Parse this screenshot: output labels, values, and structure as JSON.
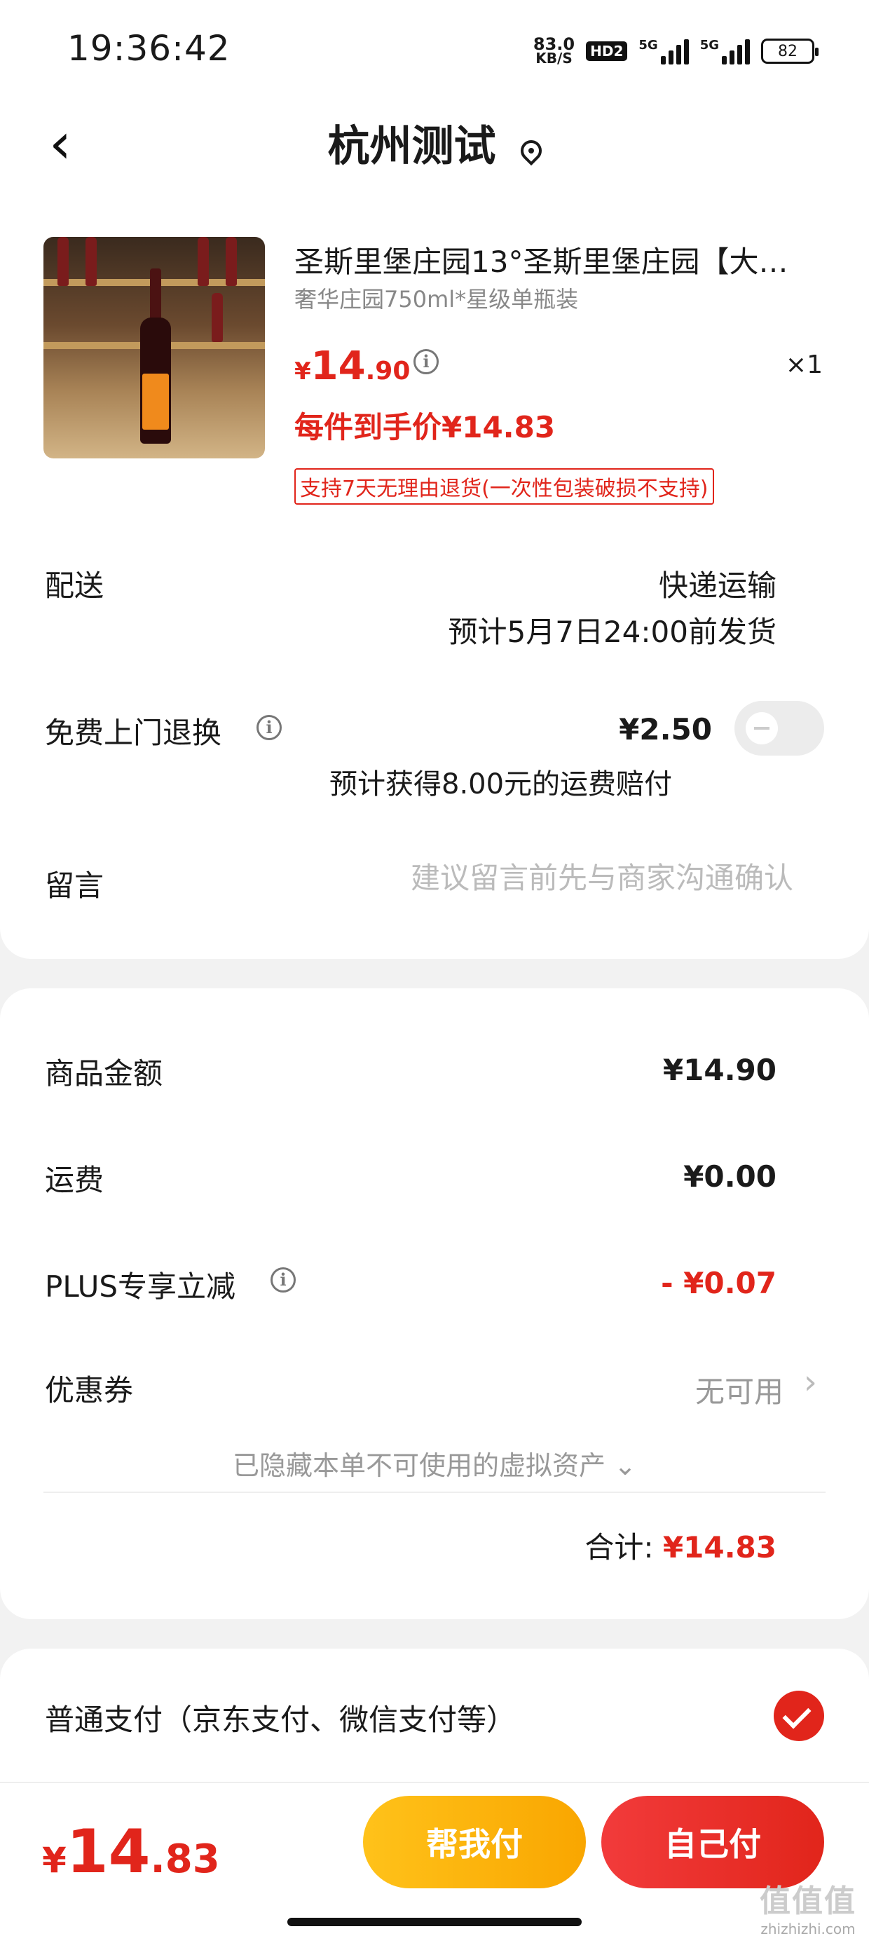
{
  "status_bar": {
    "time": "19:36:42",
    "net_speed_value": "83.0",
    "net_speed_unit": "KB/S",
    "hd_badge": "HD2",
    "signal1_tag": "5G",
    "signal2_tag": "5G",
    "battery": "82"
  },
  "header": {
    "back_icon": "chevron-left-icon",
    "title": "杭州测试",
    "location_icon": "location-pin-icon"
  },
  "product": {
    "image_icon": "wine-bottle-image",
    "name": "圣斯里堡庄园13°圣斯里堡庄园【大…",
    "spec": "奢华庄园750ml*星级单瓶装",
    "price_currency": "¥",
    "price_int": "14",
    "price_dec": ".90",
    "quantity": "×1",
    "per_item_price": "每件到手价¥14.83",
    "return_policy": "支持7天无理由退货(一次性包装破损不支持)"
  },
  "delivery": {
    "label": "配送",
    "method": "快递运输",
    "eta": "预计5月7日24:00前发货"
  },
  "free_return": {
    "label": "免费上门退换",
    "price": "¥2.50",
    "enabled": false,
    "compensation": "预计获得8.00元的运费赔付"
  },
  "message": {
    "label": "留言",
    "placeholder": "建议留言前先与商家沟通确认"
  },
  "summary": {
    "goods_label": "商品金额",
    "goods_value": "¥14.90",
    "shipping_label": "运费",
    "shipping_value": "¥0.00",
    "plus_label": "PLUS专享立减",
    "plus_value": "- ¥0.07",
    "coupon_label": "优惠券",
    "coupon_value": "无可用",
    "hidden_assets": "已隐藏本单不可使用的虚拟资产 ⌄",
    "total_label": "合计:",
    "total_value": "¥14.83"
  },
  "payment": {
    "option_label": "普通支付（京东支付、微信支付等）",
    "selected": true
  },
  "bottom_bar": {
    "currency": "¥",
    "total_int": "14",
    "total_dec": ".83",
    "help_pay_label": "帮我付",
    "self_pay_label": "自己付"
  },
  "watermark": {
    "big": "值值值",
    "small": "zhizhizhi.com"
  },
  "colors": {
    "accent_red": "#e1251b",
    "accent_yellow": "#ffc21a"
  }
}
